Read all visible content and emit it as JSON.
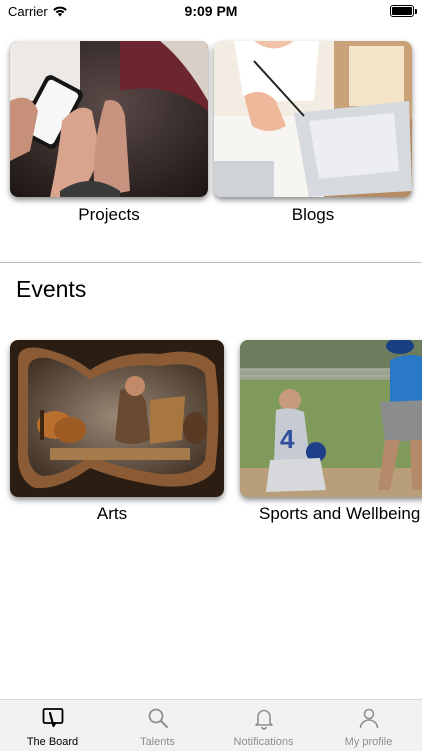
{
  "status_bar": {
    "carrier": "Carrier",
    "time": "9:09 PM"
  },
  "categories": [
    {
      "label": "Projects"
    },
    {
      "label": "Blogs"
    }
  ],
  "events": {
    "title": "Events",
    "items": [
      {
        "label": "Arts"
      },
      {
        "label": "Sports and Wellbeing"
      }
    ]
  },
  "tabbar": {
    "items": [
      {
        "label": "The Board",
        "icon": "board-icon",
        "active": true
      },
      {
        "label": "Talents",
        "icon": "search-icon",
        "active": false
      },
      {
        "label": "Notifications",
        "icon": "bell-icon",
        "active": false
      },
      {
        "label": "My profile",
        "icon": "profile-icon",
        "active": false
      }
    ]
  },
  "colors": {
    "active_tab": "#000000",
    "inactive_tab": "#8e8e93",
    "tabbar_bg": "#f2f2f2"
  }
}
